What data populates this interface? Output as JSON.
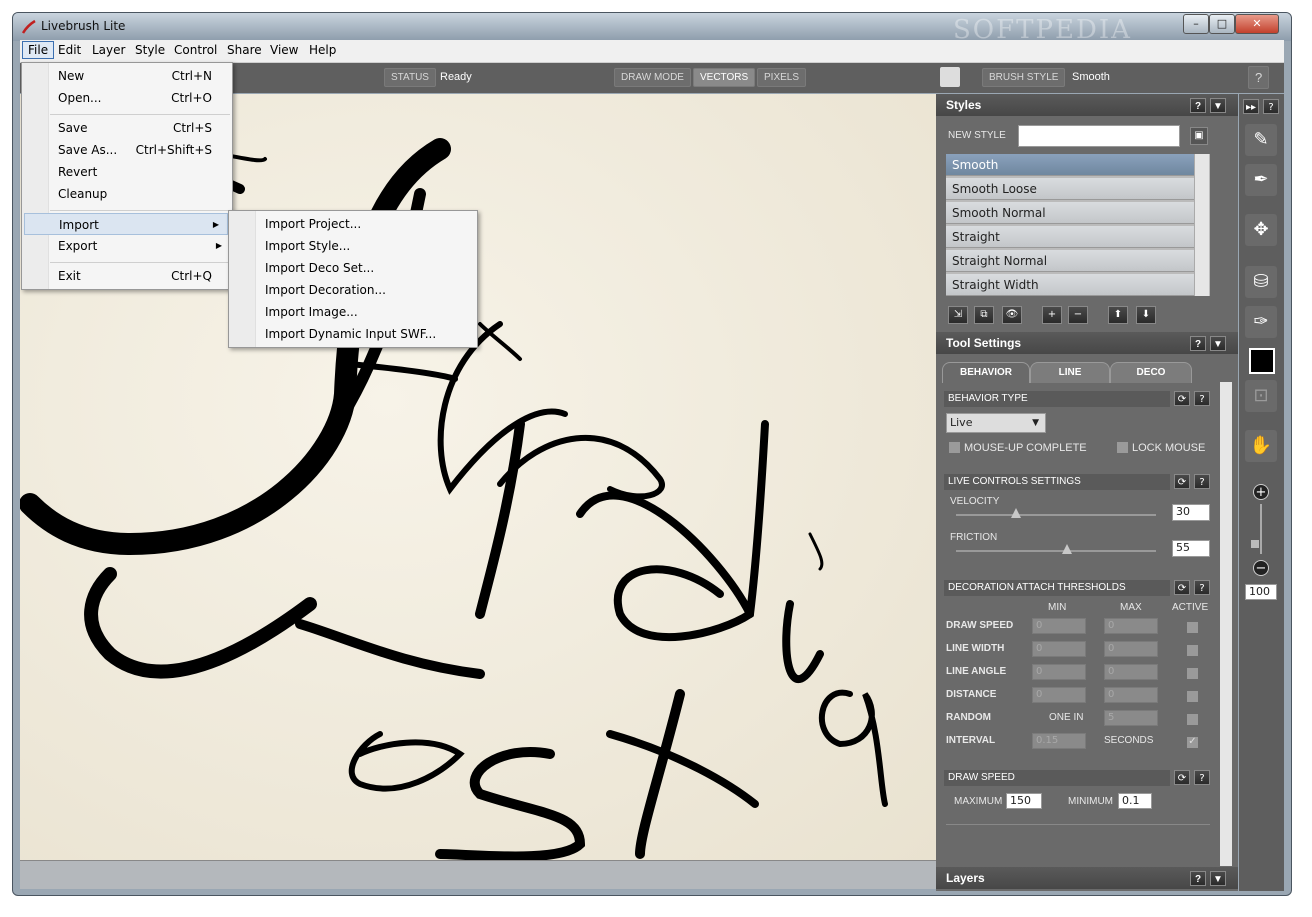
{
  "window": {
    "title": "Livebrush Lite",
    "minimize": "–",
    "maximize": "□",
    "close": "✕",
    "watermark": "SOFTPEDIA"
  },
  "menubar": [
    "File",
    "Edit",
    "Layer",
    "Style",
    "Control",
    "Share",
    "View",
    "Help"
  ],
  "file_menu": {
    "items": [
      {
        "label": "New",
        "shortcut": "Ctrl+N"
      },
      {
        "label": "Open...",
        "shortcut": "Ctrl+O"
      },
      {
        "label": "Save",
        "shortcut": "Ctrl+S"
      },
      {
        "label": "Save As...",
        "shortcut": "Ctrl+Shift+S"
      },
      {
        "label": "Revert",
        "shortcut": ""
      },
      {
        "label": "Cleanup",
        "shortcut": ""
      },
      {
        "label": "Import",
        "shortcut": ""
      },
      {
        "label": "Export",
        "shortcut": ""
      },
      {
        "label": "Exit",
        "shortcut": "Ctrl+Q"
      }
    ],
    "submenu_arrow": "▶"
  },
  "import_submenu": [
    "Import Project...",
    "Import Style...",
    "Import Deco Set...",
    "Import Decoration...",
    "Import Image...",
    "Import Dynamic Input SWF..."
  ],
  "toolbar": {
    "status_label": "STATUS",
    "status_value": "Ready",
    "draw_mode_label": "DRAW MODE",
    "vectors": "VECTORS",
    "pixels": "PIXELS",
    "brush_style_label": "BRUSH STYLE",
    "brush_style_value": "Smooth",
    "help": "?"
  },
  "styles_panel": {
    "title": "Styles",
    "help": "?",
    "collapse": "▼",
    "new_style_label": "NEW STYLE",
    "new_style_value": "",
    "items": [
      "Smooth",
      "Smooth Loose",
      "Smooth Normal",
      "Straight",
      "Straight Normal",
      "Straight Width"
    ],
    "selected": "Smooth",
    "icons": [
      "import-style-icon",
      "copy-style-icon",
      "preview-icon",
      "add-icon",
      "remove-icon",
      "move-up-icon",
      "move-down-icon"
    ],
    "icon_glyphs": [
      "⇲",
      "⧉",
      "👁",
      "+",
      "−",
      "⬆",
      "⬇"
    ]
  },
  "tool_settings": {
    "title": "Tool Settings",
    "help": "?",
    "collapse": "▼",
    "tabs": [
      "BEHAVIOR",
      "LINE",
      "DECO"
    ],
    "behavior_type_label": "BEHAVIOR TYPE",
    "behavior_type_value": "Live",
    "mouse_up_complete": "MOUSE-UP COMPLETE",
    "lock_mouse": "LOCK MOUSE",
    "live_controls_label": "LIVE CONTROLS SETTINGS",
    "velocity_label": "VELOCITY",
    "velocity_value": "30",
    "friction_label": "FRICTION",
    "friction_value": "55",
    "deco_thresholds_label": "DECORATION ATTACH THRESHOLDS",
    "col_min": "MIN",
    "col_max": "MAX",
    "col_active": "ACTIVE",
    "rows": [
      {
        "label": "DRAW SPEED",
        "min": "0",
        "max": "0"
      },
      {
        "label": "LINE WIDTH",
        "min": "0",
        "max": "0"
      },
      {
        "label": "LINE ANGLE",
        "min": "0",
        "max": "0"
      },
      {
        "label": "DISTANCE",
        "min": "0",
        "max": "0"
      }
    ],
    "random_label": "RANDOM",
    "one_in_label": "ONE IN",
    "one_in_value": "5",
    "interval_label": "INTERVAL",
    "interval_value": "0.15",
    "seconds_label": "SECONDS",
    "draw_speed_label": "DRAW SPEED",
    "maximum_label": "MAXIMUM",
    "maximum_value": "150",
    "minimum_label": "MINIMUM",
    "minimum_value": "0.1",
    "refresh": "⟳"
  },
  "layers_panel": {
    "title": "Layers",
    "help": "?",
    "collapse": "▼"
  },
  "toolbox": {
    "zoom_value": "100",
    "expand": "▸▸",
    "help": "?",
    "zoom_in": "+",
    "zoom_out": "−"
  },
  "colors": {
    "canvas": "#f2ede0",
    "panel": "#6a6a6a",
    "selected_style": "#7a92ad"
  }
}
